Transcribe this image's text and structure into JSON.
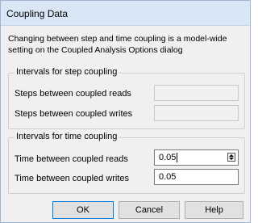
{
  "window": {
    "title": "Coupling Data"
  },
  "intro": "Changing between step and time coupling is a model-wide setting on the Coupled Analysis Options dialog",
  "step_group": {
    "legend": "Intervals for step coupling",
    "reads_label": "Steps between coupled reads",
    "reads_value": "",
    "writes_label": "Steps between coupled writes",
    "writes_value": ""
  },
  "time_group": {
    "legend": "Intervals for time coupling",
    "reads_label": "Time between coupled reads",
    "reads_value": "0.05",
    "writes_label": "Time between coupled writes",
    "writes_value": "0.05"
  },
  "buttons": {
    "ok": "OK",
    "cancel": "Cancel",
    "help": "Help"
  },
  "icons": {
    "spinner": "spinner-icon"
  }
}
